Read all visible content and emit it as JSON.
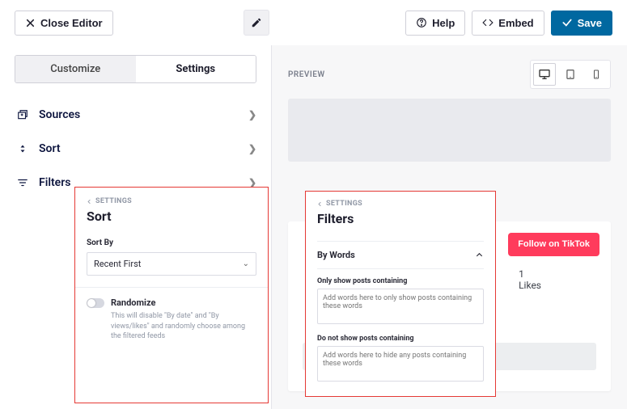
{
  "topbar": {
    "close_label": "Close Editor",
    "help_label": "Help",
    "embed_label": "Embed",
    "save_label": "Save"
  },
  "tabs": {
    "customize": "Customize",
    "settings": "Settings"
  },
  "menu": {
    "sources": "Sources",
    "sort": "Sort",
    "filters": "Filters"
  },
  "sort_panel": {
    "crumb": "SETTINGS",
    "title": "Sort",
    "sort_by_label": "Sort By",
    "sort_by_value": "Recent First",
    "randomize_label": "Randomize",
    "randomize_help": "This will disable \"By date\" and \"By views/likes\" and randomly choose among the filtered feeds"
  },
  "filters_panel": {
    "crumb": "SETTINGS",
    "title": "Filters",
    "by_words": "By Words",
    "only_show_label": "Only show posts containing",
    "only_show_placeholder": "Add words here to only show posts containing these words",
    "dont_show_label": "Do not show posts containing",
    "dont_show_placeholder": "Add words here to hide any posts containing these words"
  },
  "preview": {
    "label": "PREVIEW",
    "follow_label": "Follow on TikTok",
    "likes_num": "1",
    "likes_text": "Likes"
  }
}
